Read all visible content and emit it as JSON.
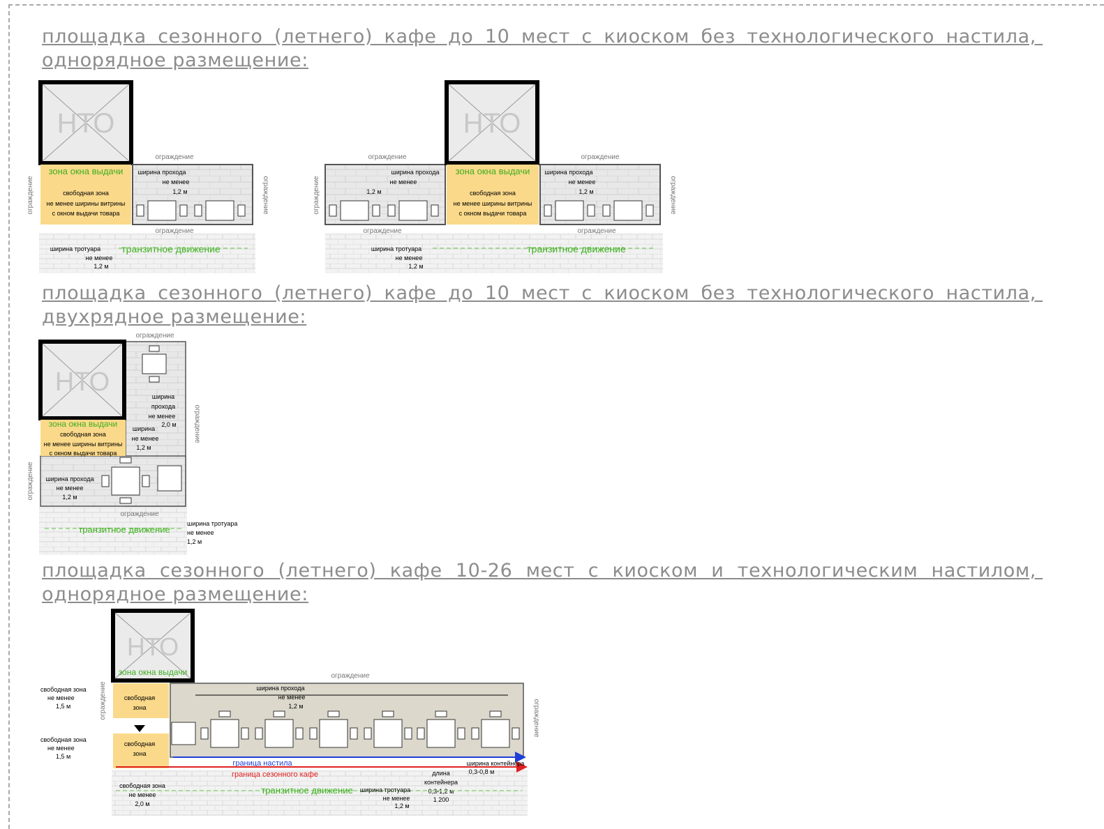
{
  "headings": [
    "площадка сезонного (летнего) кафе до 10 мест с киоском без технологического настила, однорядное размещение:",
    "площадка сезонного (летнего) кафе до 10 мест с киоском без технологического настила, двухрядное размещение:",
    "площадка сезонного (летнего) кафе 10-26 мест с киоском и технологическим настилом, однорядное размещение:"
  ],
  "labels": {
    "nto": "НТО",
    "fence": "ограждение",
    "window_zone": "зона окна выдачи",
    "free_zone": "свободная зона",
    "not_less_than_vitrine": "не менее ширины витрины",
    "with_window": "с окном выдачи товара",
    "passage_width": "ширина прохода",
    "not_less": "не менее",
    "width_12": "1,2 м",
    "width_20": "2,0 м",
    "width_15": "1,5 м",
    "sidewalk_width": "ширина тротуара",
    "transit": "транзитное движение",
    "width_word": "ширина",
    "passage_word": "прохода",
    "deck_border": "граница настила",
    "cafe_border": "граница сезонного кафе",
    "container_width": "ширина контейнера",
    "container_width_val": "0,3-0,8 м",
    "container_length": "длина",
    "container_word": "контейнера",
    "container_length_val": "0,3-1,2 м",
    "container_len_num": "1 200",
    "free_zone_short": "свободная",
    "zone_word": "зона"
  },
  "colors": {
    "heading": "#8c8c8c",
    "yellow_zone": "#fbd98a",
    "green_text": "#3cb01e",
    "blue_border": "#1f3fd6",
    "red_border": "#e02020",
    "tan_deck": "#dcd8cc",
    "grid_gray": "#e3e3e3"
  }
}
